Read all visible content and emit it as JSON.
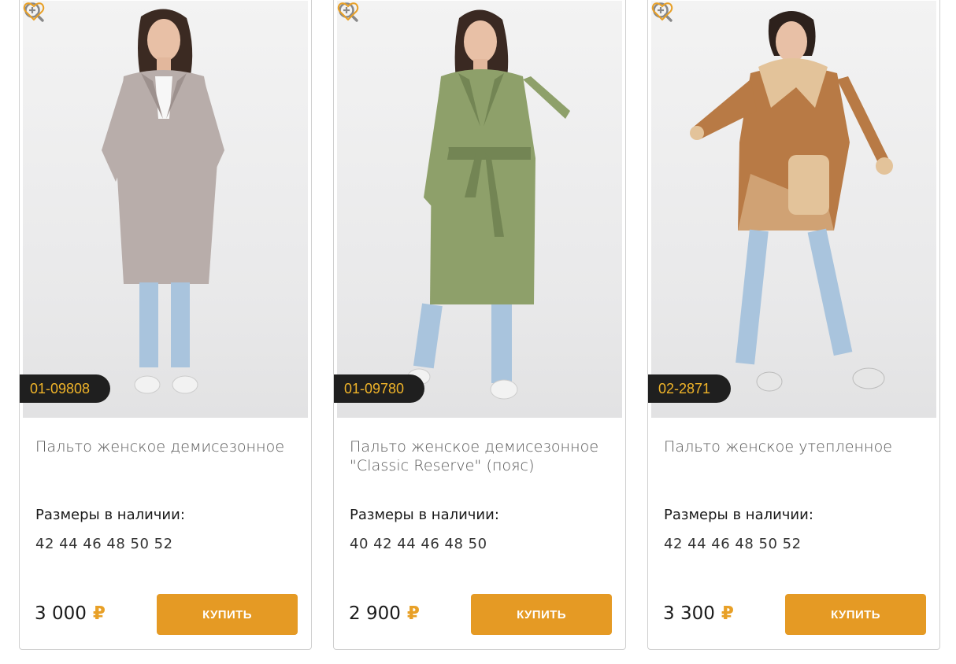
{
  "products": [
    {
      "sku": "01-09808",
      "title": "Пальто женское демисезонное",
      "sizes_label": "Размеры в наличии:",
      "sizes": "42 44 46 48 50 52",
      "price": "3 000",
      "currency": "₽",
      "buy_label": "КУПИТЬ",
      "coat_color": "#b8adaa",
      "coat_shadow": "#9d918e"
    },
    {
      "sku": "01-09780",
      "title": "Пальто женское демисезонное \"Classic Reserve\" (пояс)",
      "sizes_label": "Размеры в наличии:",
      "sizes": "40 42 44 46 48 50",
      "price": "2 900",
      "currency": "₽",
      "buy_label": "КУПИТЬ",
      "coat_color": "#8ea06a",
      "coat_shadow": "#738554"
    },
    {
      "sku": "02-2871",
      "title": "Пальто женское утепленное",
      "sizes_label": "Размеры в наличии:",
      "sizes": "42 44 46 48 50 52",
      "price": "3 300",
      "currency": "₽",
      "buy_label": "КУПИТЬ",
      "coat_color": "#b87a45",
      "coat_shadow": "#9a6233"
    }
  ],
  "colors": {
    "accent": "#e59a24",
    "sku_text": "#f0b429",
    "sku_bg": "#1f1f1f",
    "icon": "#888888",
    "heart": "#e8a027"
  }
}
